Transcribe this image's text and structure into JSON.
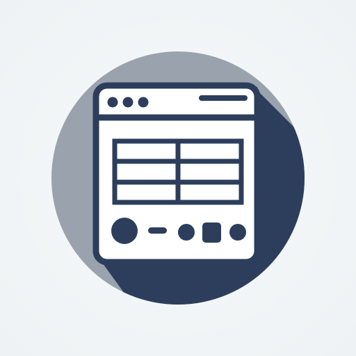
{
  "icon": {
    "name": "browser-window-app-icon",
    "colors": {
      "background": "#f2f5f6",
      "circle": "#9aa3ad",
      "shadow": "#2c3e5c",
      "window_fill": "#ffffff",
      "stroke": "#2c3e5c"
    },
    "window": {
      "traffic_lights": 3,
      "title_bar_line": true
    },
    "grid": {
      "rows": 3,
      "columns": 2
    },
    "controls": [
      "large-circle",
      "dash",
      "small-circle",
      "rounded-square",
      "small-circle"
    ]
  }
}
